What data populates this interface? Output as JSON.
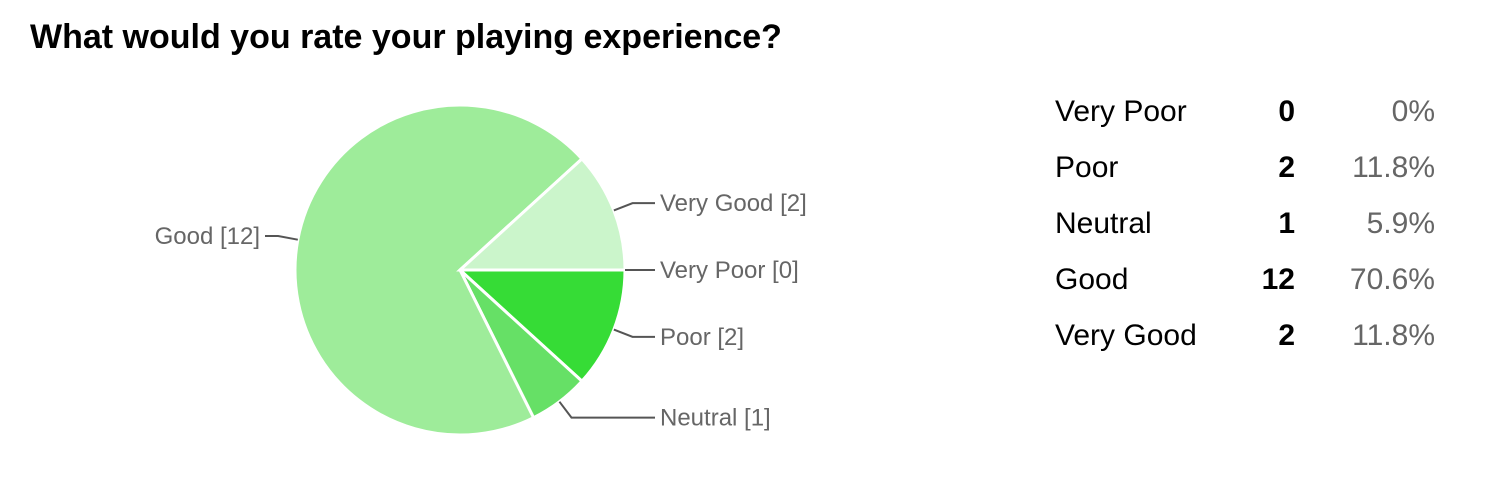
{
  "title": "What would you rate your playing experience?",
  "chart_data": {
    "type": "pie",
    "title": "What would you rate your playing experience?",
    "categories": [
      "Very Poor",
      "Poor",
      "Neutral",
      "Good",
      "Very Good"
    ],
    "values": [
      0,
      2,
      1,
      12,
      2
    ],
    "percentages": [
      "0%",
      "11.8%",
      "5.9%",
      "70.6%",
      "11.8%"
    ],
    "slice_labels": [
      "Very Poor [0]",
      "Poor [2]",
      "Neutral [1]",
      "Good [12]",
      "Very Good [2]"
    ],
    "colors": [
      "#5ed85e",
      "#36dc36",
      "#66e066",
      "#9eec9a",
      "#cbf5cb"
    ],
    "legend": "labels beside slices with leader lines"
  },
  "summary_rows": [
    {
      "label": "Very Poor",
      "count": "0",
      "percent": "0%"
    },
    {
      "label": "Poor",
      "count": "2",
      "percent": "11.8%"
    },
    {
      "label": "Neutral",
      "count": "1",
      "percent": "5.9%"
    },
    {
      "label": "Good",
      "count": "12",
      "percent": "70.6%"
    },
    {
      "label": "Very Good",
      "count": "2",
      "percent": "11.8%"
    }
  ]
}
